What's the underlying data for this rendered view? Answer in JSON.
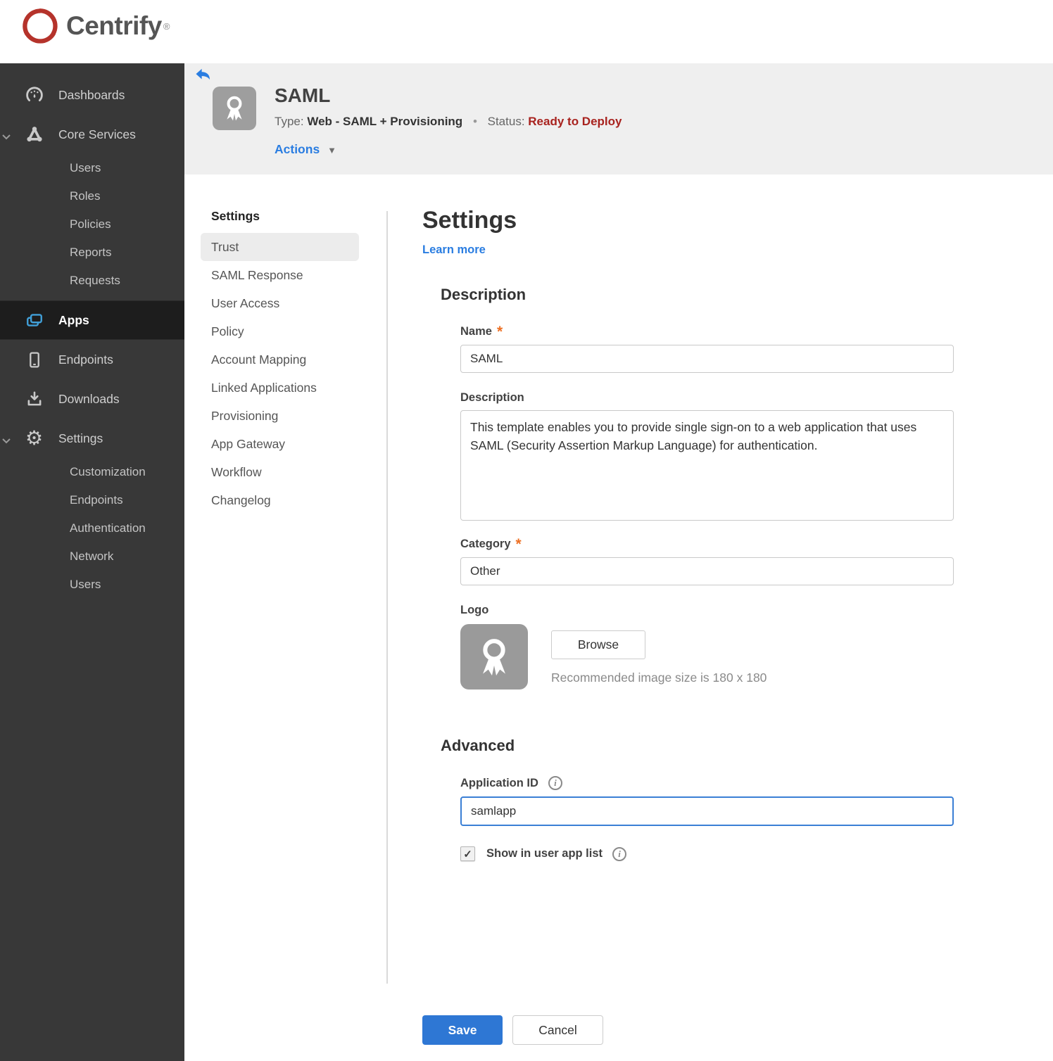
{
  "brand": {
    "name": "Centrify",
    "trademark": "®"
  },
  "sidebar": {
    "dashboards": "Dashboards",
    "core_services": "Core Services",
    "core_services_children": [
      "Users",
      "Roles",
      "Policies",
      "Reports",
      "Requests"
    ],
    "apps": "Apps",
    "endpoints": "Endpoints",
    "downloads": "Downloads",
    "settings": "Settings",
    "settings_children": [
      "Customization",
      "Endpoints",
      "Authentication",
      "Network",
      "Users"
    ]
  },
  "app_header": {
    "title": "SAML",
    "type_label": "Type:",
    "type_value": "Web - SAML + Provisioning",
    "separator": "•",
    "status_label": "Status:",
    "status_value": "Ready to Deploy",
    "actions_label": "Actions"
  },
  "subnav": {
    "header": "Settings",
    "selected": "Trust",
    "items": [
      "Trust",
      "SAML Response",
      "User Access",
      "Policy",
      "Account Mapping",
      "Linked Applications",
      "Provisioning",
      "App Gateway",
      "Workflow",
      "Changelog"
    ]
  },
  "main": {
    "title": "Settings",
    "learn_more": "Learn more",
    "description_section": {
      "heading": "Description",
      "name_label": "Name",
      "name_value": "SAML",
      "description_label": "Description",
      "description_value": "This template enables you to provide single sign-on to a web application that uses SAML (Security Assertion Markup Language) for authentication.",
      "category_label": "Category",
      "category_value": "Other",
      "logo_label": "Logo",
      "browse_label": "Browse",
      "logo_hint": "Recommended image size is 180 x 180"
    },
    "advanced_section": {
      "heading": "Advanced",
      "application_id_label": "Application ID",
      "application_id_value": "samlapp",
      "show_in_app_list_label": "Show in user app list",
      "show_in_app_list_checked": true
    },
    "footer": {
      "save_label": "Save",
      "cancel_label": "Cancel"
    }
  },
  "icons": {
    "required_mark": "*",
    "actions_caret": "▼",
    "info_glyph": "i",
    "checkbox_check": "✓",
    "gear_glyph": "⚙"
  },
  "colors": {
    "accent_blue": "#2a7de1",
    "save_blue": "#2e77d4",
    "status_red": "#a8221e",
    "apps_icon_blue": "#41a0d9",
    "required_orange": "#ed7024",
    "logo_red": "#b5332b",
    "sidebar_bg": "#383838",
    "sidebar_active_bg": "#1d1d1d",
    "header_bg": "#efefef",
    "subnav_selected_bg": "#ececec"
  }
}
